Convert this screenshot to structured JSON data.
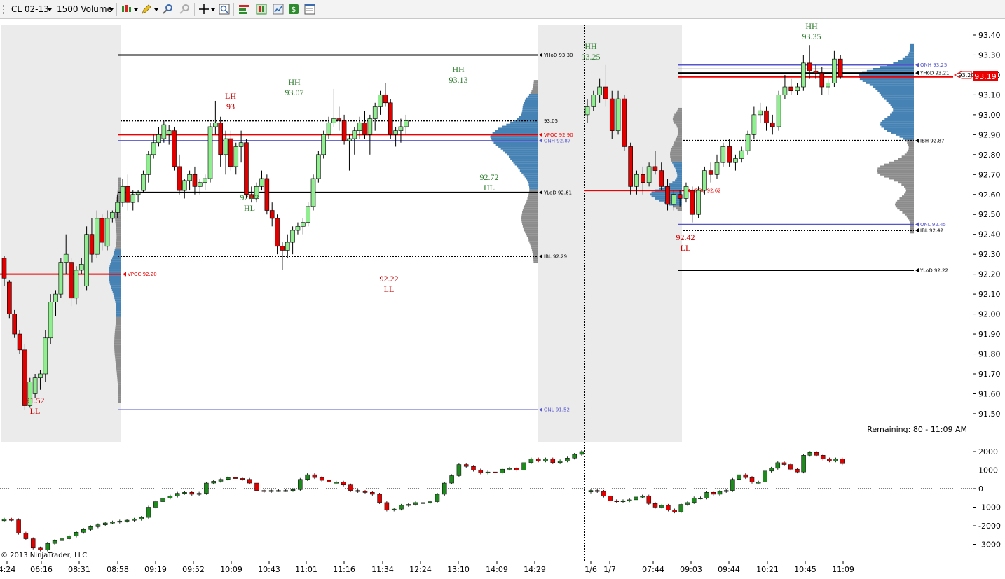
{
  "toolbar": {
    "instrument": "CL 02-13",
    "period": "1500 Volume"
  },
  "chart_data": {
    "type": "candlestick",
    "y_range": [
      91.45,
      93.47
    ],
    "indicator_range": [
      -3500,
      2300
    ],
    "price_ticks": [
      "93.40",
      "93.30",
      "93.20",
      "93.10",
      "93.00",
      "92.90",
      "92.80",
      "92.70",
      "92.60",
      "92.50",
      "92.40",
      "92.30",
      "92.20",
      "92.10",
      "92.00",
      "91.90",
      "91.80",
      "91.70",
      "91.60",
      "91.50"
    ],
    "indicator_ticks": [
      "2000",
      "1000",
      "0",
      "-1000",
      "-2000",
      "-3000"
    ],
    "time_labels": [
      "4:24",
      "06:16",
      "08:31",
      "08:58",
      "09:19",
      "09:52",
      "10:09",
      "10:43",
      "11:01",
      "11:16",
      "11:34",
      "12:24",
      "13:10",
      "14:09",
      "14:29",
      "1/6",
      "1/7",
      "07:44",
      "09:03",
      "09:44",
      "10:21",
      "10:45",
      "11:09"
    ],
    "last_price": "93.19",
    "last_price_marker": "93.20",
    "remaining": "Remaining: 80 - 11:09 AM",
    "copyright": "© 2013 NinjaTrader, LLC",
    "annotations": [
      {
        "price": "91.52",
        "tag": "LL"
      },
      {
        "price": "93",
        "tag": "LH"
      },
      {
        "price": "93.07",
        "tag": "HH"
      },
      {
        "price": "92.62",
        "tag": "HL"
      },
      {
        "price": "93.13",
        "tag": "HH"
      },
      {
        "price": "92.22",
        "tag": "LL"
      },
      {
        "price": "92.72",
        "tag": "HL"
      },
      {
        "price": "93.25",
        "tag": "HH"
      },
      {
        "price": "92.42",
        "tag": "LL"
      },
      {
        "price": "93.35",
        "tag": "HH"
      }
    ],
    "levels": [
      {
        "label": "YHoD 93.30",
        "price": 93.3
      },
      {
        "label": "VPOC 92.90",
        "price": 92.9
      },
      {
        "label": "ONH 92.87",
        "price": 92.87
      },
      {
        "label": "YLoD 92.61",
        "price": 92.61
      },
      {
        "label": "IBL 92.29",
        "price": 92.29
      },
      {
        "label": "VPOC 92.20",
        "price": 92.2
      },
      {
        "label": "ONL 91.52",
        "price": 91.52
      },
      {
        "label": "ONH 93.25",
        "price": 93.25
      },
      {
        "label": "YHoD 93.21",
        "price": 93.21
      },
      {
        "label": "IBH 92.87",
        "price": 92.87
      },
      {
        "label": "ONL 92.45",
        "price": 92.45
      },
      {
        "label": "IBL 92.42",
        "price": 92.42
      },
      {
        "label": "YLoD 92.22",
        "price": 92.22
      },
      {
        "label": "VPOC 92.62",
        "price": 92.62
      },
      {
        "label": "93.05",
        "price": 92.97
      }
    ],
    "day1": [
      [
        92.28,
        92.29,
        92.14,
        92.18
      ],
      [
        92.16,
        92.17,
        91.98,
        92.0
      ],
      [
        92.0,
        92.02,
        91.88,
        91.9
      ],
      [
        91.9,
        91.92,
        91.8,
        91.82
      ],
      [
        91.82,
        91.85,
        91.52,
        91.54
      ],
      [
        91.54,
        91.68,
        91.53,
        91.66
      ],
      [
        91.6,
        91.7,
        91.58,
        91.68
      ],
      [
        91.68,
        91.72,
        91.62,
        91.7
      ],
      [
        91.7,
        91.92,
        91.66,
        91.88
      ],
      [
        91.88,
        92.1,
        91.85,
        92.06
      ],
      [
        92.06,
        92.12,
        91.99,
        92.1
      ],
      [
        92.1,
        92.28,
        92.08,
        92.26
      ],
      [
        92.26,
        92.4,
        92.2,
        92.3
      ],
      [
        92.26,
        92.28,
        92.04,
        92.08
      ],
      [
        92.08,
        92.24,
        92.05,
        92.22
      ],
      [
        92.22,
        92.28,
        92.2,
        92.25
      ],
      [
        92.14,
        92.44,
        92.12,
        92.4
      ],
      [
        92.4,
        92.48,
        92.26,
        92.3
      ],
      [
        92.3,
        92.52,
        92.28,
        92.48
      ],
      [
        92.48,
        92.5,
        92.32,
        92.36
      ],
      [
        92.34,
        92.52,
        92.32,
        92.48
      ],
      [
        92.48,
        92.52,
        92.46,
        92.51
      ],
      [
        92.51,
        92.6,
        92.48,
        92.56
      ],
      [
        92.56,
        92.68,
        92.54,
        92.64
      ],
      [
        92.64,
        92.7,
        92.52,
        92.56
      ],
      [
        92.56,
        92.62,
        92.52,
        92.6
      ],
      [
        92.6,
        92.62,
        92.56,
        92.61
      ],
      [
        92.62,
        92.72,
        92.61,
        92.7
      ],
      [
        92.7,
        92.82,
        92.66,
        92.8
      ],
      [
        92.8,
        92.9,
        92.78,
        92.86
      ],
      [
        92.86,
        92.94,
        92.84,
        92.9
      ],
      [
        92.88,
        92.97,
        92.86,
        92.95
      ],
      [
        92.9,
        92.95,
        92.85,
        92.92
      ],
      [
        92.92,
        92.94,
        92.72,
        92.74
      ],
      [
        92.74,
        92.8,
        92.6,
        92.62
      ],
      [
        92.62,
        92.68,
        92.58,
        92.67
      ],
      [
        92.67,
        92.72,
        92.62,
        92.7
      ],
      [
        92.7,
        92.74,
        92.6,
        92.64
      ],
      [
        92.64,
        92.68,
        92.6,
        92.66
      ],
      [
        92.66,
        92.7,
        92.62,
        92.68
      ],
      [
        92.68,
        92.96,
        92.66,
        92.94
      ],
      [
        92.94,
        93.07,
        92.9,
        92.96
      ],
      [
        92.96,
        92.99,
        92.74,
        92.8
      ],
      [
        92.8,
        92.92,
        92.7,
        92.88
      ],
      [
        92.88,
        92.92,
        92.72,
        92.74
      ],
      [
        92.74,
        92.86,
        92.7,
        92.84
      ],
      [
        92.84,
        92.92,
        92.76,
        92.86
      ],
      [
        92.86,
        92.88,
        92.58,
        92.6
      ],
      [
        92.6,
        92.64,
        92.56,
        92.58
      ],
      [
        92.58,
        92.66,
        92.56,
        92.64
      ],
      [
        92.64,
        92.72,
        92.62,
        92.68
      ],
      [
        92.68,
        92.7,
        92.5,
        92.52
      ],
      [
        92.52,
        92.56,
        92.44,
        92.48
      ],
      [
        92.48,
        92.5,
        92.3,
        92.34
      ],
      [
        92.34,
        92.36,
        92.22,
        92.32
      ],
      [
        92.32,
        92.4,
        92.28,
        92.36
      ],
      [
        92.36,
        92.44,
        92.3,
        92.42
      ],
      [
        92.42,
        92.46,
        92.4,
        92.44
      ],
      [
        92.44,
        92.48,
        92.4,
        92.46
      ],
      [
        92.46,
        92.56,
        92.44,
        92.54
      ],
      [
        92.54,
        92.7,
        92.52,
        92.68
      ],
      [
        92.68,
        92.82,
        92.66,
        92.8
      ],
      [
        92.8,
        92.92,
        92.78,
        92.9
      ],
      [
        92.9,
        92.99,
        92.88,
        92.96
      ],
      [
        92.96,
        93.13,
        92.94,
        92.98
      ],
      [
        92.98,
        93.04,
        92.92,
        92.97
      ],
      [
        92.97,
        93.0,
        92.85,
        92.87
      ],
      [
        92.87,
        92.9,
        92.72,
        92.88
      ],
      [
        92.88,
        92.94,
        92.8,
        92.92
      ],
      [
        92.92,
        92.99,
        92.88,
        92.96
      ],
      [
        92.96,
        93.02,
        92.88,
        92.9
      ],
      [
        92.9,
        93.0,
        92.8,
        92.98
      ],
      [
        92.98,
        93.06,
        92.92,
        93.04
      ],
      [
        93.04,
        93.12,
        93.0,
        93.1
      ],
      [
        93.1,
        93.16,
        93.04,
        93.06
      ],
      [
        93.06,
        93.08,
        92.88,
        92.9
      ],
      [
        92.9,
        92.94,
        92.84,
        92.92
      ],
      [
        92.92,
        92.98,
        92.86,
        92.94
      ],
      [
        92.94,
        93.0,
        92.9,
        92.97
      ]
    ],
    "day2": [
      [
        93.0,
        93.08,
        92.96,
        93.04
      ],
      [
        93.04,
        93.12,
        93.02,
        93.1
      ],
      [
        93.1,
        93.18,
        93.06,
        93.14
      ],
      [
        93.14,
        93.25,
        93.04,
        93.08
      ],
      [
        93.08,
        93.12,
        92.88,
        92.92
      ],
      [
        92.92,
        93.12,
        92.9,
        93.08
      ],
      [
        93.08,
        93.1,
        92.82,
        92.84
      ],
      [
        92.84,
        92.86,
        92.6,
        92.64
      ],
      [
        92.64,
        92.72,
        92.6,
        92.7
      ],
      [
        92.7,
        92.74,
        92.6,
        92.66
      ],
      [
        92.66,
        92.76,
        92.64,
        92.74
      ],
      [
        92.74,
        92.82,
        92.7,
        92.72
      ],
      [
        92.72,
        92.76,
        92.62,
        92.64
      ],
      [
        92.64,
        92.68,
        92.52,
        92.55
      ],
      [
        92.55,
        92.62,
        92.52,
        92.6
      ],
      [
        92.6,
        92.62,
        92.54,
        92.58
      ],
      [
        92.58,
        92.66,
        92.56,
        92.64
      ],
      [
        92.62,
        92.64,
        92.46,
        92.5
      ],
      [
        92.5,
        92.64,
        92.48,
        92.62
      ],
      [
        92.62,
        92.74,
        92.6,
        92.72
      ],
      [
        92.72,
        92.76,
        92.66,
        92.7
      ],
      [
        92.7,
        92.8,
        92.68,
        92.76
      ],
      [
        92.76,
        92.86,
        92.74,
        92.84
      ],
      [
        92.84,
        92.88,
        92.74,
        92.76
      ],
      [
        92.76,
        92.8,
        92.72,
        92.78
      ],
      [
        92.78,
        92.84,
        92.76,
        92.82
      ],
      [
        92.82,
        92.92,
        92.8,
        92.9
      ],
      [
        92.9,
        93.04,
        92.88,
        93.0
      ],
      [
        93.0,
        93.06,
        92.96,
        93.02
      ],
      [
        93.02,
        93.04,
        92.92,
        92.96
      ],
      [
        92.96,
        93.0,
        92.9,
        92.94
      ],
      [
        92.94,
        93.12,
        92.92,
        93.1
      ],
      [
        93.1,
        93.2,
        93.08,
        93.14
      ],
      [
        93.14,
        93.18,
        93.1,
        93.12
      ],
      [
        93.12,
        93.16,
        93.1,
        93.14
      ],
      [
        93.14,
        93.3,
        93.12,
        93.26
      ],
      [
        93.26,
        93.35,
        93.18,
        93.22
      ],
      [
        93.22,
        93.25,
        93.18,
        93.21
      ],
      [
        93.21,
        93.24,
        93.1,
        93.14
      ],
      [
        93.14,
        93.18,
        93.1,
        93.16
      ],
      [
        93.16,
        93.32,
        93.14,
        93.28
      ],
      [
        93.28,
        93.3,
        93.18,
        93.19
      ]
    ],
    "indicator1": [
      -1650,
      -1680,
      -2400,
      -2700,
      -3200,
      -3300,
      -2950,
      -2800,
      -2700,
      -2550,
      -2350,
      -2200,
      -2050,
      -1950,
      -1850,
      -1800,
      -1750,
      -1700,
      -1650,
      -1550,
      -1000,
      -700,
      -500,
      -400,
      -250,
      -200,
      -300,
      -250,
      300,
      400,
      500,
      600,
      550,
      500,
      300,
      -100,
      -150,
      -100,
      -100,
      -100,
      -50,
      500,
      750,
      600,
      450,
      350,
      350,
      200,
      -100,
      -150,
      -200,
      -300,
      -750,
      -1150,
      -1100,
      -900,
      -850,
      -750,
      -750,
      -700,
      -300,
      300,
      700,
      1300,
      1200,
      1000,
      850,
      900,
      850,
      1050,
      1100,
      1000,
      1400,
      1600,
      1500,
      1600,
      1400,
      1500,
      1650,
      1850,
      2000
    ],
    "indicator2": [
      -100,
      -150,
      -400,
      -650,
      -700,
      -650,
      -600,
      -450,
      -400,
      -800,
      -1000,
      -900,
      -1150,
      -1250,
      -850,
      -750,
      -500,
      -500,
      -200,
      -300,
      -150,
      -100,
      500,
      750,
      600,
      350,
      350,
      950,
      1100,
      1400,
      1300,
      1050,
      900,
      1800,
      1950,
      1800,
      1600,
      1500,
      1600,
      1350
    ]
  }
}
